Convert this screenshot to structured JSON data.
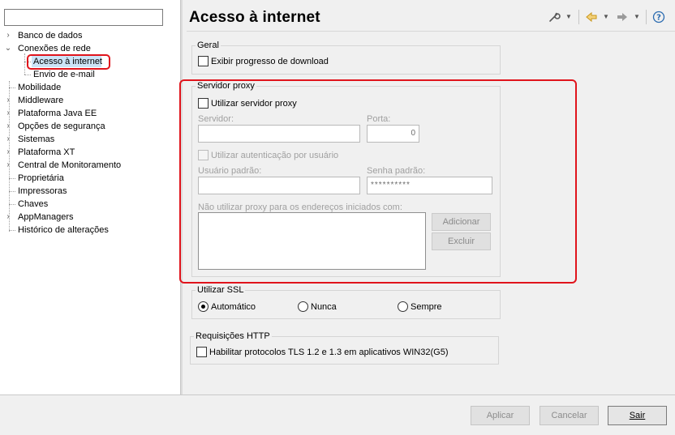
{
  "filter": {
    "value": "",
    "placeholder": ""
  },
  "tree": {
    "items": [
      {
        "label": "Banco de dados",
        "expanded": false
      },
      {
        "label": "Conexões de rede",
        "expanded": true,
        "children": [
          {
            "label": "Acesso à internet",
            "selected": true
          },
          {
            "label": "Envio de e-mail"
          }
        ]
      },
      {
        "label": "Mobilidade",
        "expandable": false
      },
      {
        "label": "Middleware",
        "expanded": false
      },
      {
        "label": "Plataforma Java EE",
        "expanded": false
      },
      {
        "label": "Opções de segurança",
        "expanded": false
      },
      {
        "label": "Sistemas",
        "expanded": false
      },
      {
        "label": "Plataforma XT",
        "expanded": false
      },
      {
        "label": "Central de Monitoramento",
        "expanded": false
      },
      {
        "label": "Proprietária",
        "expandable": false
      },
      {
        "label": "Impressoras",
        "expandable": false
      },
      {
        "label": "Chaves",
        "expandable": false
      },
      {
        "label": "AppManagers",
        "expanded": false
      },
      {
        "label": "Histórico de alterações",
        "expandable": false
      }
    ]
  },
  "header": {
    "title": "Acesso à internet",
    "toolbar": {
      "icons": [
        "wrench-icon",
        "dropdown-arrow-icon",
        "back-arrow-icon",
        "forward-arrow-icon",
        "help-icon"
      ],
      "accent_back": "#e8b32a",
      "accent_help": "#2a6bb0"
    }
  },
  "general": {
    "legend": "Geral",
    "show_download_progress": {
      "label": "Exibir progresso de download",
      "checked": false
    }
  },
  "proxy": {
    "legend": "Servidor proxy",
    "use_proxy": {
      "label": "Utilizar servidor proxy",
      "checked": false
    },
    "server": {
      "label": "Servidor:",
      "value": ""
    },
    "port": {
      "label": "Porta:",
      "value": "0"
    },
    "use_auth": {
      "label": "Utilizar autenticação por usuário",
      "checked": false
    },
    "default_user": {
      "label": "Usuário padrão:",
      "value": ""
    },
    "default_password": {
      "label": "Senha padrão:",
      "value": "**********"
    },
    "bypass": {
      "label": "Não utilizar proxy para os endereços iniciados com:",
      "items": []
    },
    "add_button": "Adicionar",
    "remove_button": "Excluir"
  },
  "ssl": {
    "legend": "Utilizar SSL",
    "options": [
      "Automático",
      "Nunca",
      "Sempre"
    ],
    "selected": "Automático"
  },
  "http": {
    "legend": "Requisições HTTP",
    "tls": {
      "label": "Habilitar protocolos TLS 1.2 e 1.3 em aplicativos WIN32(G5)",
      "checked": false
    }
  },
  "footer": {
    "apply": "Aplicar",
    "cancel": "Cancelar",
    "exit": "Sair"
  },
  "colors": {
    "highlight": "#e0141c",
    "selection": "#cce4f7"
  }
}
